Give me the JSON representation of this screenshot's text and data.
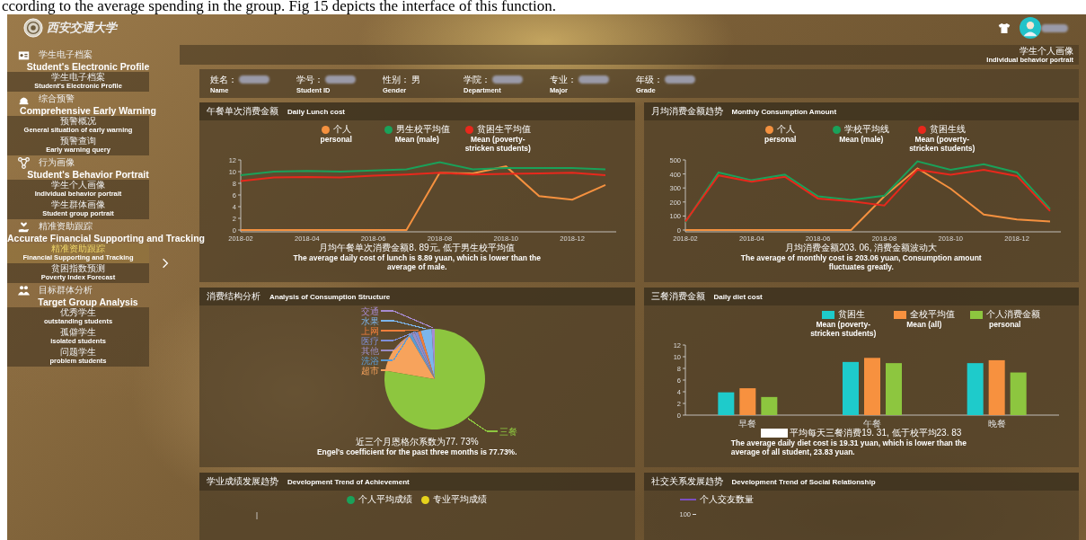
{
  "caption": "ccording to the average spending in the group. Fig 15 depicts the interface of this function.",
  "header": {
    "logo_text": "西安交通大学"
  },
  "sidebar": {
    "groups": [
      {
        "title_zh": "学生电子档案",
        "title_en": "Student's Electronic Profile",
        "items": [
          {
            "zh": "学生电子档案",
            "en": "Student's Electronic Profile",
            "selected": false
          }
        ]
      },
      {
        "title_zh": "综合预警",
        "title_en": "Comprehensive Early Warning",
        "items": [
          {
            "zh": "预警概况",
            "en": "General situation of early warning",
            "selected": false
          },
          {
            "zh": "预警查询",
            "en": "Early warning query",
            "selected": false
          }
        ]
      },
      {
        "title_zh": "行为画像",
        "title_en": "Student's Behavior Portrait",
        "items": [
          {
            "zh": "学生个人画像",
            "en": "Individual behavior portrait",
            "selected": false
          },
          {
            "zh": "学生群体画像",
            "en": "Student group portrait",
            "selected": false
          }
        ]
      },
      {
        "title_zh": "精准资助跟踪",
        "title_en": "Accurate Financial Supporting and Tracking",
        "items": [
          {
            "zh": "精准资助跟踪",
            "en": "Financial Supporting and Tracking",
            "selected": true
          },
          {
            "zh": "贫困指数预测",
            "en": "Poverty Index Forecast",
            "selected": false
          }
        ]
      },
      {
        "title_zh": "目标群体分析",
        "title_en": "Target Group Analysis",
        "items": [
          {
            "zh": "优秀学生",
            "en": "outstanding students",
            "selected": false
          },
          {
            "zh": "孤僻学生",
            "en": "isolated students",
            "selected": false
          },
          {
            "zh": "问题学生",
            "en": "problem students",
            "selected": false
          }
        ]
      }
    ]
  },
  "page_title": {
    "zh": "学生个人画像",
    "en": "Individual behavior portrait"
  },
  "profile_fields": [
    {
      "label_zh": "姓名：",
      "label_en": "Name",
      "kind": "redacted"
    },
    {
      "label_zh": "学号：",
      "label_en": "Student ID",
      "kind": "redacted"
    },
    {
      "label_zh": "性别：",
      "label_en": "Gender",
      "kind": "text",
      "value": "男"
    },
    {
      "label_zh": "学院：",
      "label_en": "Department",
      "kind": "redacted"
    },
    {
      "label_zh": "专业：",
      "label_en": "Major",
      "kind": "redacted"
    },
    {
      "label_zh": "年级：",
      "label_en": "Grade",
      "kind": "redacted"
    }
  ],
  "panels": [
    {
      "kind": "line",
      "title_zh": "午餐单次消费金额",
      "title_en": "Daily Lunch cost",
      "legend_en": [
        "personal",
        "Mean (male)",
        "Mean (poverty-stricken students)"
      ],
      "summary_zh": "月均午餐单次消费金额8. 89元, 低于男生校平均值",
      "summary_en": "The average daily cost of lunch is 8.89 yuan, which is lower than the average of male.",
      "chart_data": {
        "type": "line",
        "legend": "top",
        "categories": [
          "2018-02",
          null,
          "2018-04",
          null,
          "2018-06",
          null,
          "2018-08",
          null,
          "2018-10",
          null,
          "2018-12",
          null
        ],
        "ylim": [
          0,
          12
        ],
        "yticks": [
          0,
          2,
          4,
          6,
          8,
          10,
          12
        ],
        "series": [
          {
            "name": "个人",
            "color": "#f5913f",
            "values": [
              0,
              0,
              0,
              0,
              0,
              0,
              9.8,
              9.7,
              10.9,
              5.8,
              5.2,
              7.7
            ]
          },
          {
            "name": "男生校平均值",
            "color": "#1aa15a",
            "values": [
              9.4,
              10.0,
              10.1,
              10.0,
              10.2,
              10.4,
              11.6,
              10.4,
              10.6,
              10.6,
              10.6,
              10.4
            ]
          },
          {
            "name": "贫困生平均值",
            "color": "#e8281c",
            "values": [
              8.4,
              9.0,
              9.1,
              9.0,
              9.3,
              9.5,
              9.8,
              9.5,
              9.6,
              9.7,
              9.8,
              9.4
            ]
          }
        ]
      }
    },
    {
      "kind": "line",
      "title_zh": "月均消费金额趋势",
      "title_en": "Monthly Consumption Amount",
      "legend_en": [
        "personal",
        "Mean (male)",
        "Mean (poverty-stricken students)"
      ],
      "summary_zh": "月均消费金额203. 06, 消费金额波动大",
      "summary_en": "The average of monthly cost is 203.06 yuan, Consumption amount fluctuates greatly.",
      "chart_data": {
        "type": "line",
        "legend": "top",
        "categories": [
          "2018-02",
          null,
          "2018-04",
          null,
          "2018-06",
          null,
          "2018-08",
          null,
          "2018-10",
          null,
          "2018-12",
          null
        ],
        "ylim": [
          0,
          500
        ],
        "yticks": [
          0,
          100,
          200,
          300,
          400,
          500
        ],
        "series": [
          {
            "name": "个人",
            "color": "#f5913f",
            "values": [
              0,
              0,
              0,
              0,
              0,
              0,
              240,
              440,
              295,
              110,
              75,
              60
            ]
          },
          {
            "name": "学校平均线",
            "color": "#1aa15a",
            "values": [
              55,
              410,
              355,
              395,
              240,
              215,
              245,
              490,
              430,
              470,
              410,
              150
            ]
          },
          {
            "name": "贫困生线",
            "color": "#e8281c",
            "values": [
              60,
              390,
              345,
              380,
              225,
              205,
              175,
              430,
              395,
              430,
              385,
              135
            ]
          }
        ]
      }
    },
    {
      "kind": "pie",
      "title_zh": "消费结构分析",
      "title_en": "Analysis of Consumption Structure",
      "summary_zh": "近三个月恩格尔系数为77. 73%",
      "summary_en": "Engel's coefficient for the past three months is 77.73%.",
      "slice_labels": [
        {
          "label": "交通",
          "color": "#a78bd1"
        },
        {
          "label": "水果",
          "color": "#7cb5ec"
        },
        {
          "label": "上网",
          "color": "#f07f3c"
        },
        {
          "label": "医疗",
          "color": "#7f8fd8"
        },
        {
          "label": "其他",
          "color": "#9b8ec4"
        },
        {
          "label": "洗浴",
          "color": "#5b9bd5"
        },
        {
          "label": "超市",
          "color": "#f7a35c"
        },
        {
          "label": "三餐",
          "color": "#8dc63f"
        }
      ]
    },
    {
      "kind": "bar",
      "title_zh": "三餐消费金额",
      "title_en": "Daily diet cost",
      "legend_en": [
        "Mean (poverty-stricken students)",
        "Mean (all)",
        "personal"
      ],
      "summary_zh": "平均每天三餐消费19. 31, 低于校平均23. 83",
      "summary_en": "The average daily diet cost is 19.31 yuan, which is lower than the average of all student, 23.83 yuan.",
      "chart_data": {
        "type": "bar",
        "legend": "top-right",
        "categories": [
          "早餐",
          "午餐",
          "晚餐"
        ],
        "ylim": [
          0,
          12
        ],
        "yticks": [
          0,
          2,
          4,
          6,
          8,
          10,
          12
        ],
        "series": [
          {
            "name": "贫困生",
            "color": "#1ecbcb",
            "values": [
              3.9,
              9.1,
              8.9
            ]
          },
          {
            "name": "全校平均值",
            "color": "#f7913f",
            "values": [
              4.6,
              9.8,
              9.4
            ]
          },
          {
            "name": "个人消费金额",
            "color": "#8dc63f",
            "values": [
              3.1,
              8.9,
              7.3
            ]
          }
        ]
      }
    },
    {
      "kind": "dots",
      "title_zh": "学业成绩发展趋势",
      "title_en": "Development Trend of Achievement",
      "legend": [
        {
          "label": "个人平均成绩",
          "color": "#1aa15a"
        },
        {
          "label": "专业平均成绩",
          "color": "#e6d21c"
        }
      ]
    },
    {
      "kind": "lineleg",
      "title_zh": "社交关系发展趋势",
      "title_en": "Development Trend  of Social Relationship",
      "legend": [
        {
          "label": "个人交友数量",
          "color": "#7b4fc0"
        }
      ],
      "tick": "100"
    }
  ]
}
